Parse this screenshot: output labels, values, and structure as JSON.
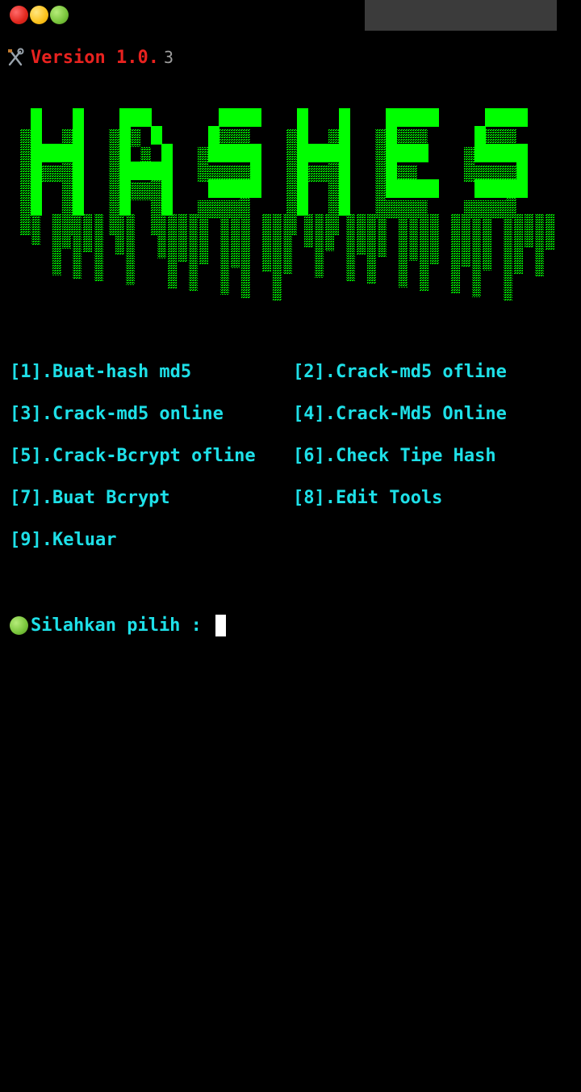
{
  "window": {
    "controls": [
      "close-dot",
      "minimize-dot",
      "maximize-dot"
    ]
  },
  "header": {
    "version_label": "Version 1.0.",
    "version_number": "3",
    "icon": "tools-icon"
  },
  "banner": {
    "text": "HASHES",
    "color": "#00ff00"
  },
  "menu": {
    "rows": [
      [
        {
          "label": "[1].Buat-hash md5"
        },
        {
          "label": "[2].Crack-md5 ofline"
        }
      ],
      [
        {
          "label": "[3].Crack-md5 online"
        },
        {
          "label": "[4].Crack-Md5 Online"
        }
      ],
      [
        {
          "label": "[5].Crack-Bcrypt ofline"
        },
        {
          "label": "[6].Check Tipe Hash"
        }
      ],
      [
        {
          "label": "[7].Buat Bcrypt"
        },
        {
          "label": "[8].Edit Tools"
        }
      ],
      [
        {
          "label": "[9].Keluar"
        }
      ]
    ]
  },
  "prompt": {
    "label": "Silahkan pilih : ",
    "value": ""
  },
  "colors": {
    "background": "#000000",
    "menu_text": "#1ee0e8",
    "version": "#e8221f",
    "banner": "#00ff00"
  }
}
